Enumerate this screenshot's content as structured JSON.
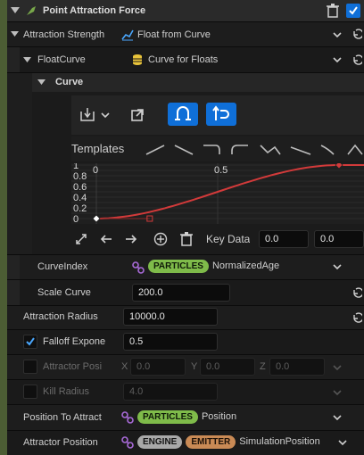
{
  "header": {
    "title": "Point Attraction Force",
    "checked": true
  },
  "attraction_strength": {
    "label": "Attraction Strength",
    "value": "Float from Curve"
  },
  "float_curve": {
    "label": "FloatCurve",
    "value": "Curve for Floats"
  },
  "curve_section": {
    "label": "Curve"
  },
  "templates": {
    "label": "Templates"
  },
  "curve_graph": {
    "y_ticks": [
      "1",
      "0.8",
      "0.6",
      "0.4",
      "0.2",
      "0"
    ],
    "x_ticks": [
      "0",
      "0.5"
    ],
    "keys": [
      {
        "x": 0.0,
        "y": 0.0
      },
      {
        "x": 1.0,
        "y": 1.0
      }
    ],
    "line_color": "#d23a3a"
  },
  "key_data": {
    "label": "Key Data",
    "time": "0.0",
    "value": "0.0"
  },
  "curve_index": {
    "label": "CurveIndex",
    "namespace": "PARTICLES",
    "attribute": "NormalizedAge"
  },
  "scale_curve": {
    "label": "Scale Curve",
    "value": "200.0"
  },
  "attraction_radius": {
    "label": "Attraction Radius",
    "value": "10000.0"
  },
  "falloff_exponent": {
    "label": "Falloff Expone",
    "value": "0.5",
    "checked": true
  },
  "attractor_position_vec": {
    "label": "Attractor Posi",
    "x_label": "X",
    "x": "0.0",
    "y_label": "Y",
    "y": "0.0",
    "z_label": "Z",
    "z": "0.0",
    "checked": false
  },
  "kill_radius": {
    "label": "Kill Radius",
    "value": "4.0",
    "checked": false
  },
  "position_to_attract": {
    "label": "Position To Attract",
    "namespace": "PARTICLES",
    "attribute": "Position"
  },
  "attractor_position": {
    "label": "Attractor Position",
    "namespace1": "ENGINE",
    "namespace2": "EMITTER",
    "attribute": "SimulationPosition"
  },
  "colors": {
    "accent": "#0f6fd8",
    "particles": "#7fbb4a",
    "engine": "#a8a8a8",
    "emitter": "#c98a55"
  }
}
